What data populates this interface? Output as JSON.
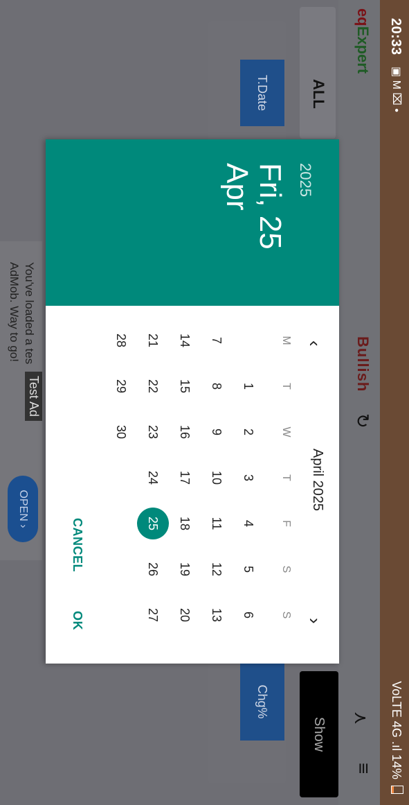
{
  "status": {
    "time": "20:33",
    "left_icons": "▣ M ⌧ •",
    "signal": "VoLTE 4G .ıl",
    "battery": "14%"
  },
  "app": {
    "brand_eq": "eq",
    "brand_expert": "Expert",
    "trend": "Bullish",
    "filter": "ALL",
    "show_button": "Show"
  },
  "table": {
    "col_date": "T.Date",
    "col_change": "Chg%"
  },
  "ad": {
    "text_line1": "You've loaded a tes",
    "text_line2": "AdMob. Way to go!",
    "tag": "Test Ad",
    "open_button": "OPEN ›"
  },
  "datepicker": {
    "year": "2025",
    "selected_line1": "Fri, 25",
    "selected_line2": "Apr",
    "month_label": "April 2025",
    "weekdays": [
      "M",
      "T",
      "W",
      "T",
      "F",
      "S",
      "S"
    ],
    "weeks": [
      [
        "",
        "1",
        "2",
        "3",
        "4",
        "5",
        "6"
      ],
      [
        "7",
        "8",
        "9",
        "10",
        "11",
        "12",
        "13"
      ],
      [
        "14",
        "15",
        "16",
        "17",
        "18",
        "19",
        "20"
      ],
      [
        "21",
        "22",
        "23",
        "24",
        "25",
        "26",
        "27"
      ],
      [
        "28",
        "29",
        "30",
        "",
        "",
        "",
        ""
      ]
    ],
    "selected_day": "25",
    "cancel": "CANCEL",
    "ok": "OK"
  },
  "colors": {
    "accent": "#00897b",
    "header_blue": "#1f4f8a"
  }
}
